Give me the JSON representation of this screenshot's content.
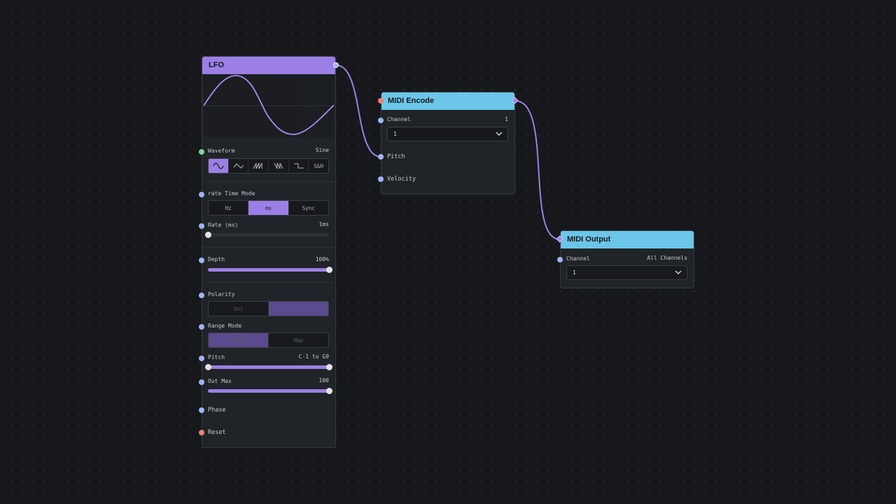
{
  "colors": {
    "accent": "#9b7fe6",
    "header_cyan": "#6bc6e9",
    "wire": "#9b7fe6",
    "port_blue": "#9fb4f5",
    "port_green": "#7fd39b",
    "port_red": "#ef8077",
    "background": "#16181b",
    "node_bg": "#202327"
  },
  "lfo": {
    "title": "LFO",
    "waveform": {
      "label": "Waveform",
      "value": "Sine",
      "options": [
        "sine-icon",
        "triangle-icon",
        "sawtooth-icon",
        "ramp-icon",
        "square-icon",
        "S&H"
      ],
      "selected_index": 0
    },
    "rate_time_mode": {
      "label": "rate Time Mode",
      "options": [
        "Hz",
        "ms",
        "Sync"
      ],
      "selected": "ms"
    },
    "rate": {
      "label": "Rate (ms)",
      "value": "1ms",
      "fraction": 0.0
    },
    "depth": {
      "label": "Depth",
      "value": "100%",
      "fraction": 1.0
    },
    "polarity": {
      "label": "Polarity",
      "options": [
        "Uni",
        "Bi"
      ],
      "selected": "Bi"
    },
    "range_mode": {
      "label": "Range Mode",
      "options": [
        "Range",
        "Map"
      ],
      "selected": "Range"
    },
    "pitch": {
      "label": "Pitch",
      "value": "C-1 to G9",
      "range_fraction": [
        0.0,
        1.0
      ]
    },
    "out_max": {
      "label": "Out Max",
      "value": "100",
      "fraction": 1.0
    },
    "phase": {
      "label": "Phase"
    },
    "reset": {
      "label": "Reset"
    }
  },
  "midi_encode": {
    "title": "MIDI Encode",
    "channel": {
      "label": "Channel",
      "value": "1",
      "selected": "1"
    },
    "pitch": {
      "label": "Pitch"
    },
    "velocity": {
      "label": "Velocity"
    }
  },
  "midi_output": {
    "title": "MIDI Output",
    "channel": {
      "label": "Channel",
      "value": "All Channels",
      "selected": "1"
    }
  }
}
